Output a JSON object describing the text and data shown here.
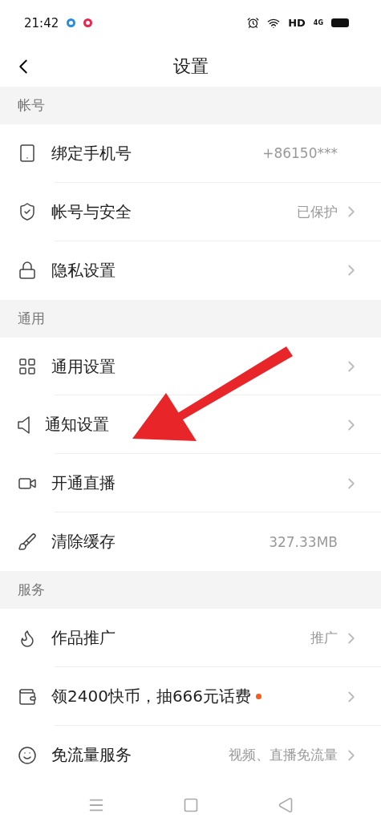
{
  "status_bar": {
    "time": "21:42",
    "hd": "HD",
    "network": "4G"
  },
  "header": {
    "title": "设置"
  },
  "sections": [
    {
      "title": "帐号",
      "items": [
        {
          "kind": "phone",
          "label": "绑定手机号",
          "value": "+86150***",
          "chevron": false,
          "dot": false
        },
        {
          "kind": "shield",
          "label": "帐号与安全",
          "value": "已保护",
          "chevron": true,
          "dot": false
        },
        {
          "kind": "lock",
          "label": "隐私设置",
          "chevron": true,
          "dot": false
        }
      ]
    },
    {
      "title": "通用",
      "items": [
        {
          "kind": "grid",
          "label": "通用设置",
          "chevron": true,
          "dot": false
        },
        {
          "kind": "speaker",
          "label": "通知设置",
          "chevron": true,
          "dot": false
        },
        {
          "kind": "camera",
          "label": "开通直播",
          "chevron": true,
          "dot": false
        },
        {
          "kind": "brush",
          "label": "清除缓存",
          "value": "327.33MB",
          "chevron": false,
          "dot": false
        }
      ]
    },
    {
      "title": "服务",
      "items": [
        {
          "kind": "flame",
          "label": "作品推广",
          "value": "推广",
          "chevron": true,
          "dot": false
        },
        {
          "kind": "coin",
          "label": "领2400快币，抽666元话费",
          "chevron": true,
          "dot": true
        },
        {
          "kind": "smile",
          "label": "免流量服务",
          "value": "视频、直播免流量",
          "chevron": true,
          "dot": false
        }
      ]
    }
  ]
}
